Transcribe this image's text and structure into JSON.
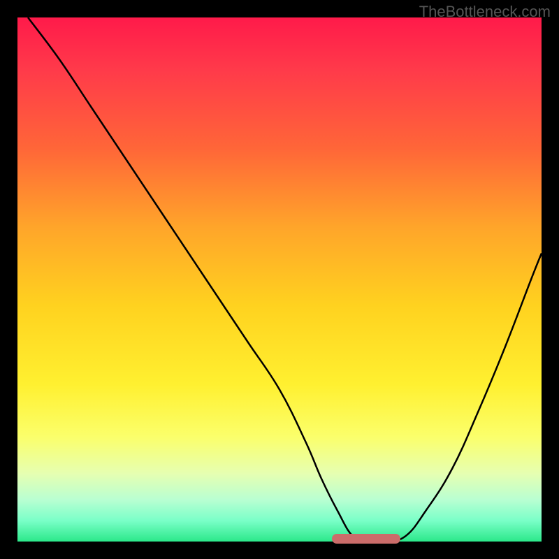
{
  "watermark": "TheBottleneck.com",
  "colors": {
    "curve": "#000000",
    "marker": "#cc6c6a",
    "frame": "#000000"
  },
  "chart_data": {
    "type": "line",
    "title": "",
    "xlabel": "",
    "ylabel": "",
    "xlim": [
      0,
      100
    ],
    "ylim": [
      0,
      100
    ],
    "series": [
      {
        "name": "bottleneck-curve",
        "x": [
          2,
          8,
          14,
          20,
          26,
          32,
          38,
          44,
          50,
          55,
          58,
          61,
          64,
          67,
          70,
          74,
          78,
          83,
          88,
          93,
          98,
          100
        ],
        "values": [
          100,
          92,
          83,
          74,
          65,
          56,
          47,
          38,
          29,
          19,
          12,
          6,
          1,
          0,
          0,
          1,
          6,
          14,
          25,
          37,
          50,
          55
        ]
      }
    ],
    "highlight_region": {
      "x_start": 60,
      "x_end": 73,
      "y": 0.6
    },
    "gradient_stops": [
      {
        "pos": 0,
        "color": "#ff1a4a"
      },
      {
        "pos": 25,
        "color": "#ff6638"
      },
      {
        "pos": 55,
        "color": "#ffd21f"
      },
      {
        "pos": 80,
        "color": "#fbff6b"
      },
      {
        "pos": 100,
        "color": "#2be88a"
      }
    ]
  }
}
